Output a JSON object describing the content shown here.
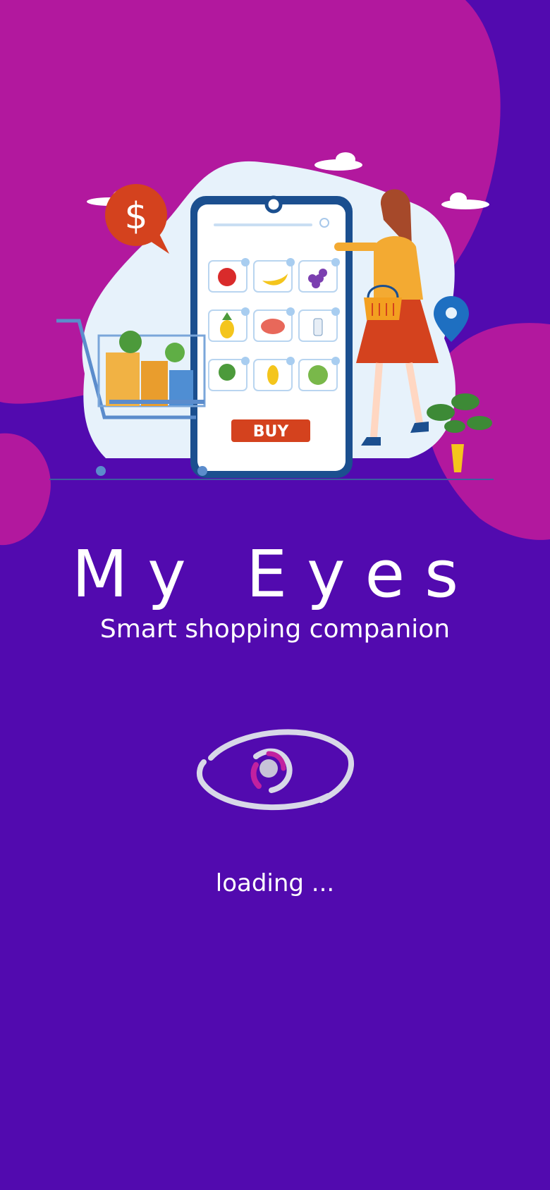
{
  "app": {
    "title": "My Eyes",
    "subtitle": "Smart shopping companion",
    "loading_text": "loading ..."
  },
  "illustration": {
    "buy_label": "BUY",
    "currency_symbol": "$"
  },
  "colors": {
    "background": "#520aaf",
    "blob": "#b2189e",
    "accent": "#d4421e"
  },
  "icons": [
    "eye-logo-icon",
    "shopping-cart-icon",
    "location-pin-icon",
    "dollar-bubble-icon"
  ]
}
